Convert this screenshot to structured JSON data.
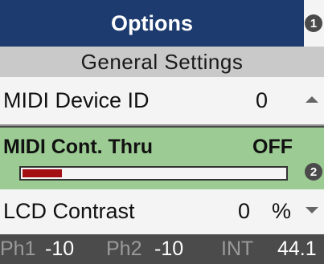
{
  "title": "Options",
  "badges": {
    "header": "1",
    "progress": "2"
  },
  "section": "General Settings",
  "rows": {
    "midi_device_id": {
      "label": "MIDI Device ID",
      "value": "0"
    },
    "midi_cont_thru": {
      "label": "MIDI Cont. Thru",
      "value": "OFF",
      "level": 0.15
    },
    "lcd_contrast": {
      "label": "LCD Contrast",
      "value": "0",
      "unit": "%"
    }
  },
  "status": {
    "ph1_label": "Ph1",
    "ph1_value": "-10",
    "ph2_label": "Ph2",
    "ph2_value": "-10",
    "int_label": "INT",
    "rate_value": "44.1"
  },
  "colors": {
    "title_bg": "#1d3b6f",
    "selected_row_bg": "#9ccc94",
    "bar_fill": "#a30f12",
    "status_bg": "#4b4b4b"
  },
  "icons": {
    "scroll_up": "triangle-up-icon",
    "scroll_down": "triangle-down-icon"
  }
}
